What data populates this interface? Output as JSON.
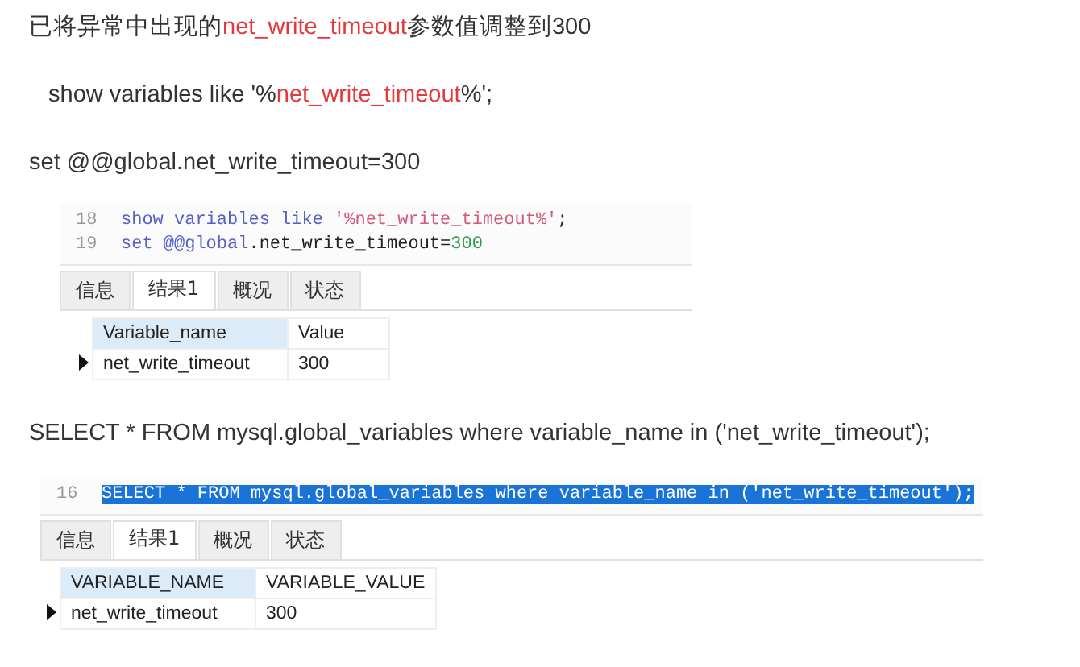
{
  "blocks": [
    {
      "kind": "paragraph",
      "indent": false,
      "segments": [
        {
          "text": "已将异常中出现的",
          "highlight": false
        },
        {
          "text": "net_write_timeout",
          "highlight": true
        },
        {
          "text": "参数值调整到300",
          "highlight": false
        }
      ]
    },
    {
      "kind": "paragraph",
      "indent": true,
      "segments": [
        {
          "text": "show variables like '%",
          "highlight": false
        },
        {
          "text": "net_write_timeout",
          "highlight": true
        },
        {
          "text": "%';",
          "highlight": false
        }
      ]
    },
    {
      "kind": "paragraph",
      "indent": false,
      "segments": [
        {
          "text": "set @@global.net_write_timeout=300",
          "highlight": false
        }
      ]
    },
    {
      "kind": "screenshot",
      "wide": false,
      "lines": [
        {
          "number": "18",
          "selected": false,
          "tokens": [
            {
              "text": "show variables like ",
              "kind": "keyword"
            },
            {
              "text": "'%net_write_timeout%'",
              "kind": "string"
            },
            {
              "text": ";",
              "kind": "plain"
            }
          ]
        },
        {
          "number": "19",
          "selected": false,
          "tokens": [
            {
              "text": "set @@",
              "kind": "keyword"
            },
            {
              "text": "global",
              "kind": "keyword"
            },
            {
              "text": ".net_write_timeout=",
              "kind": "plain"
            },
            {
              "text": "300",
              "kind": "number"
            }
          ]
        }
      ],
      "tabs": [
        {
          "label": "信息",
          "selected": false
        },
        {
          "label": "结果1",
          "selected": true
        },
        {
          "label": "概况",
          "selected": false
        },
        {
          "label": "状态",
          "selected": false
        }
      ],
      "columns": [
        "Variable_name",
        "Value"
      ],
      "rows": [
        {
          "current": true,
          "cells": [
            "net_write_timeout",
            "300"
          ]
        }
      ]
    },
    {
      "kind": "paragraph",
      "indent": false,
      "segments": [
        {
          "text": "SELECT * FROM mysql.global_variables where variable_name in ('net_write_timeout');",
          "highlight": false
        }
      ]
    },
    {
      "kind": "screenshot",
      "wide": true,
      "lines": [
        {
          "number": "16",
          "selected": true,
          "tokens": [
            {
              "text": "SELECT * FROM mysql.global_variables where variable_name in ('net_write_timeout');",
              "kind": "plain"
            }
          ]
        }
      ],
      "tabs": [
        {
          "label": "信息",
          "selected": false
        },
        {
          "label": "结果1",
          "selected": true
        },
        {
          "label": "概况",
          "selected": false
        },
        {
          "label": "状态",
          "selected": false
        }
      ],
      "columns": [
        "VARIABLE_NAME",
        "VARIABLE_VALUE"
      ],
      "rows": [
        {
          "current": true,
          "cells": [
            "net_write_timeout",
            "300"
          ]
        }
      ]
    }
  ]
}
